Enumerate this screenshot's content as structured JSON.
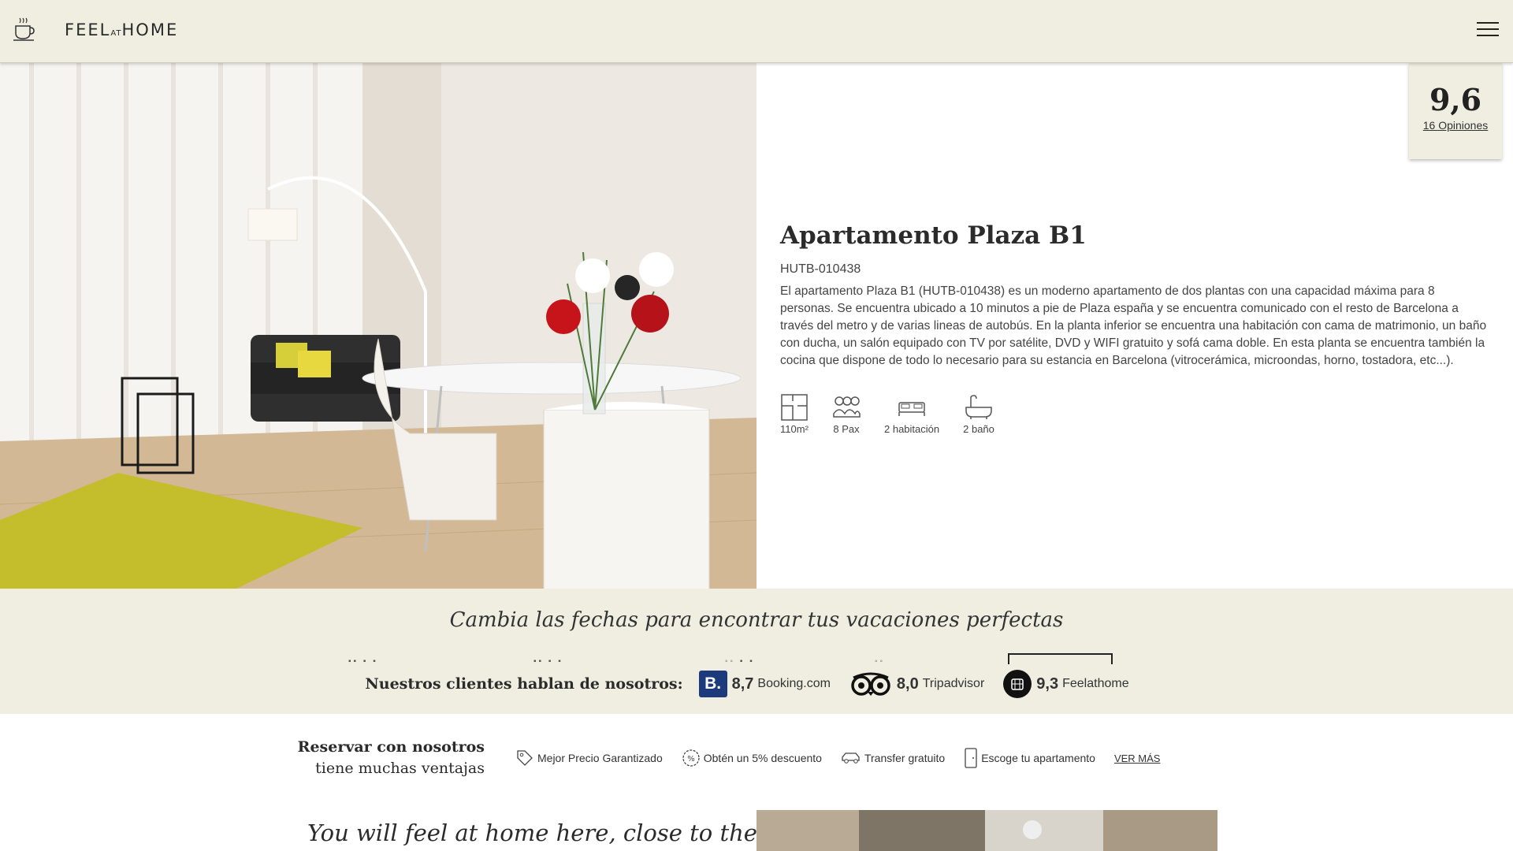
{
  "header": {
    "logo_pre": "FEEL",
    "logo_mid": "AT",
    "logo_post": "HOME",
    "menu_icon": "hamburger-menu-icon"
  },
  "rating": {
    "score": "9,6",
    "opinions_link": "16 Opiniones"
  },
  "apartment": {
    "title": "Apartamento Plaza B1",
    "code": "HUTB-010438",
    "description": "El apartamento Plaza B1 (HUTB-010438) es un moderno apartamento de dos plantas con una capacidad máxima para 8 personas. Se encuentra ubicado a 10 minutos a pie de Plaza españa y se encuentra comunicado con el resto de Barcelona a través del metro y de varias lineas de autobús. En la planta inferior se encuentra una habitación con cama de matrimonio, un baño con ducha, un salón equipado con TV por satélite, DVD y WIFI gratuito y sofá cama doble. En esta planta se encuentra también la cocina que dispone de todo lo necesario para su estancia en Barcelona (vitrocerámica, microondas, horno, tostadora, etc...).",
    "features": [
      {
        "icon": "floor-plan-icon",
        "label": "110m²"
      },
      {
        "icon": "people-icon",
        "label": "8 Pax"
      },
      {
        "icon": "bed-icon",
        "label": "2 habitación"
      },
      {
        "icon": "bathtub-icon",
        "label": "2 baño"
      }
    ]
  },
  "search_band": {
    "title": "Cambia las fechas para encontrar tus vacaciones perfectas"
  },
  "reviews": {
    "label": "Nuestros clientes hablan de nosotros:",
    "items": [
      {
        "icon": "booking-logo-icon",
        "logo_text": "B.",
        "score": "8,7",
        "name": "Booking.com"
      },
      {
        "icon": "tripadvisor-owl-icon",
        "score": "8,0",
        "name": "Tripadvisor"
      },
      {
        "icon": "feelathome-logo-icon",
        "score": "9,3",
        "name": "Feelathome"
      }
    ]
  },
  "advantages": {
    "title_line1": "Reservar con nosotros",
    "title_line2": "tiene muchas ventajas",
    "items": [
      {
        "icon": "price-tag-icon",
        "label": "Mejor Precio Garantizado"
      },
      {
        "icon": "percent-badge-icon",
        "label": "Obtén un 5% descuento"
      },
      {
        "icon": "car-icon",
        "label": "Transfer gratuito"
      },
      {
        "icon": "phone-icon",
        "label": "Escoge tu apartamento"
      }
    ],
    "more_link": "VER MÁS"
  },
  "bottom": {
    "title": "You will feel at home here, close to the city"
  }
}
